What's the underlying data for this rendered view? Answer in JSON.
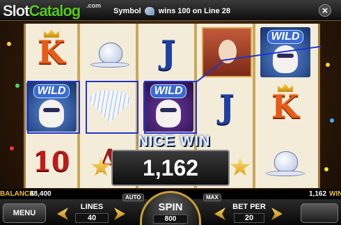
{
  "brand": {
    "logo_slot": "Slot",
    "logo_catalog": "Catalog",
    "logo_com": ".com"
  },
  "top_message": {
    "prefix": "Symbol",
    "suffix": "wins 100 on Line 28",
    "symbol_icon": "fan-icon"
  },
  "close_label": "×",
  "reels": {
    "col1": [
      "K",
      "WILD",
      "10"
    ],
    "col2": [
      "teapot",
      "fan",
      "A"
    ],
    "col3": [
      "J",
      "WILD",
      ""
    ],
    "col4": [
      "queen",
      "J",
      ""
    ],
    "col5": [
      "WILD",
      "K",
      "teapot"
    ]
  },
  "win": {
    "banner": "NICE WIN",
    "amount": "1,162"
  },
  "info_bar": {
    "balance_label": "BALANCE",
    "balance_value": "48,400",
    "win_value": "1,162",
    "win_label": "WIN"
  },
  "controls": {
    "menu": "MENU",
    "lines_label": "LINES",
    "lines_value": "40",
    "auto": "AUTO",
    "max": "MAX",
    "spin_label": "SPIN",
    "spin_value": "800",
    "bet_label": "BET PER",
    "bet_value": "20"
  },
  "colors": {
    "payline": "#2233cc",
    "brand_green": "#58c81e",
    "gold": "#c9a030"
  }
}
